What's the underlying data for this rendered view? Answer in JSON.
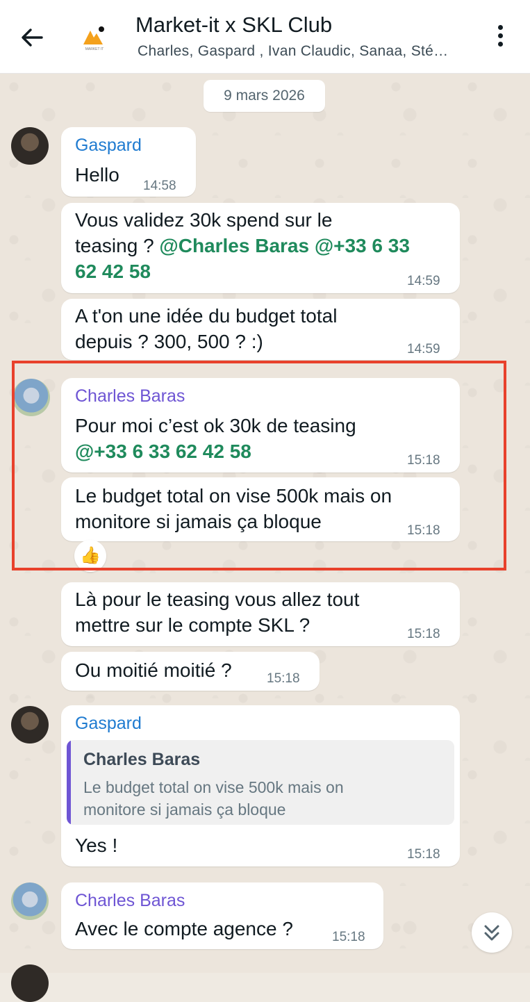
{
  "header": {
    "title": "Market-it x SKL Club",
    "members": "Charles, Gaspard , Ivan Claudic, Sanaa, Sté…",
    "logo_text": "MARKET IT"
  },
  "date_chip": "9 mars 2026",
  "messages": [
    {
      "sender": "Gaspard",
      "text": "Hello",
      "time": "14:58"
    },
    {
      "text_line1": "Vous validez 30k spend sur le",
      "text_line2_plain": "teasing ? ",
      "text_line2_mention": "@Charles Baras @+33 6 33",
      "text_line3_mention": "62 42 58",
      "time": "14:59"
    },
    {
      "text_line1": "A t'on une idée du budget total",
      "text_line2": "depuis ? 300, 500 ? :)",
      "time": "14:59"
    },
    {
      "sender": "Charles Baras",
      "text_line1": "Pour moi c’est ok 30k de teasing",
      "text_line2_mention": "@+33 6 33 62 42 58",
      "time": "15:18"
    },
    {
      "text_line1": "Le budget total on vise 500k mais on",
      "text_line2": "monitore si jamais ça bloque",
      "time": "15:18",
      "reaction": "👍"
    },
    {
      "text_line1": "Là pour le teasing vous allez tout",
      "text_line2": "mettre sur le compte SKL ?",
      "time": "15:18"
    },
    {
      "text": "Ou moitié moitié ?",
      "time": "15:18"
    },
    {
      "sender": "Gaspard",
      "quote_author": "Charles Baras",
      "quote_line1": "Le budget total on vise 500k mais on",
      "quote_line2": "monitore si jamais ça bloque",
      "text": "Yes !",
      "time": "15:18"
    },
    {
      "sender": "Charles Baras",
      "text": "Avec le compte agence ?",
      "time": "15:18"
    }
  ],
  "colors": {
    "highlight": "#e8412c",
    "mention": "#1f8a5c",
    "sender_gaspard": "#1f7bd0",
    "sender_charles": "#6e55d4"
  }
}
